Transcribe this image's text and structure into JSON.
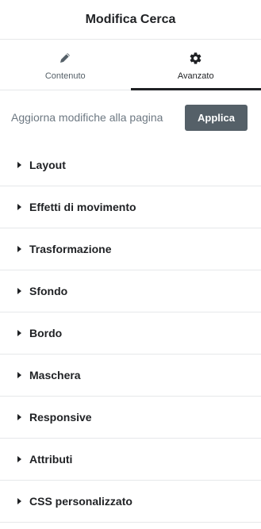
{
  "header": {
    "title": "Modifica Cerca"
  },
  "tabs": [
    {
      "label": "Contenuto",
      "icon": "pencil-icon",
      "active": false
    },
    {
      "label": "Avanzato",
      "icon": "gear-icon",
      "active": true
    }
  ],
  "apply": {
    "text": "Aggiorna modifiche alla pagina",
    "button_label": "Applica"
  },
  "sections": [
    {
      "label": "Layout"
    },
    {
      "label": "Effetti di movimento"
    },
    {
      "label": "Trasformazione"
    },
    {
      "label": "Sfondo"
    },
    {
      "label": "Bordo"
    },
    {
      "label": "Maschera"
    },
    {
      "label": "Responsive"
    },
    {
      "label": "Attributi"
    },
    {
      "label": "CSS personalizzato"
    }
  ],
  "colors": {
    "accent": "#1f2124",
    "button_bg": "#556068",
    "divider": "#e6e8ea"
  }
}
